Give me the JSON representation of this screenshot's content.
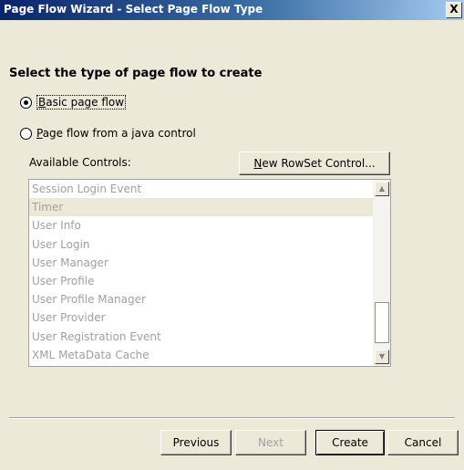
{
  "window": {
    "title": "Page Flow Wizard - Select Page Flow Type",
    "close_glyph": "X"
  },
  "heading": "Select the type of page flow to create",
  "options": {
    "basic": {
      "accel": "B",
      "rest": "asic page flow",
      "checked": true
    },
    "java_control": {
      "accel": "P",
      "rest": "age flow from a java control",
      "checked": false
    }
  },
  "controls": {
    "label": "Available Controls:",
    "new_rowset_accel": "N",
    "new_rowset_rest": "ew RowSet Control...",
    "items": [
      "Session Login Event",
      "Timer",
      "User Info",
      "User Login",
      "User Manager",
      "User Profile",
      "User Profile Manager",
      "User Provider",
      "User Registration Event",
      "XML MetaData Cache"
    ],
    "selected_item": "Timer"
  },
  "footer": {
    "previous": "Previous",
    "next": "Next",
    "create": "Create",
    "cancel": "Cancel"
  }
}
